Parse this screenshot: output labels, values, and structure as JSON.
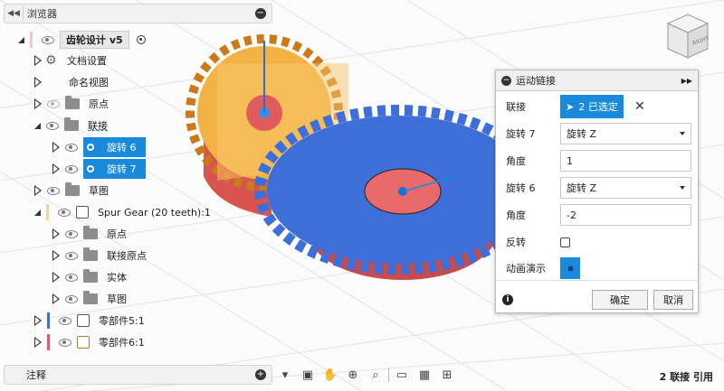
{
  "browser": {
    "title": "浏览器",
    "tree": [
      {
        "label": "齿轮设计 v5",
        "level": 0
      },
      {
        "label": "文档设置",
        "level": 1
      },
      {
        "label": "命名视图",
        "level": 1
      },
      {
        "label": "原点",
        "level": 1
      },
      {
        "label": "联接",
        "level": 1
      },
      {
        "label": "旋转 6",
        "level": 2
      },
      {
        "label": "旋转 7",
        "level": 2
      },
      {
        "label": "草图",
        "level": 1
      },
      {
        "label": "Spur Gear (20 teeth):1",
        "level": 1
      },
      {
        "label": "原点",
        "level": 2
      },
      {
        "label": "联接原点",
        "level": 2
      },
      {
        "label": "实体",
        "level": 2
      },
      {
        "label": "草图",
        "level": 2
      },
      {
        "label": "零部件5:1",
        "level": 1
      },
      {
        "label": "零部件6:1",
        "level": 1
      }
    ]
  },
  "dialog": {
    "title": "运动链接",
    "joint_label": "联接",
    "selection_button": "2 已选定",
    "rows": [
      {
        "label": "旋转 7",
        "value": "旋转 Z",
        "kind": "select"
      },
      {
        "label": "角度",
        "value": "1",
        "kind": "input"
      },
      {
        "label": "旋转 6",
        "value": "旋转 Z",
        "kind": "select"
      },
      {
        "label": "角度",
        "value": "-2",
        "kind": "input"
      }
    ],
    "reverse_label": "反转",
    "animate_label": "动画演示",
    "ok_label": "确定",
    "cancel_label": "取消"
  },
  "annotations": {
    "title": "注释"
  },
  "status": {
    "text": "2 联接 引用"
  },
  "colors": {
    "accent": "#1a8bdc",
    "gear_small": "#f2b344",
    "gear_large": "#3e6fd8",
    "base_red": "#e05c5c"
  },
  "viewcube": {
    "face_label": "RIGHT"
  }
}
